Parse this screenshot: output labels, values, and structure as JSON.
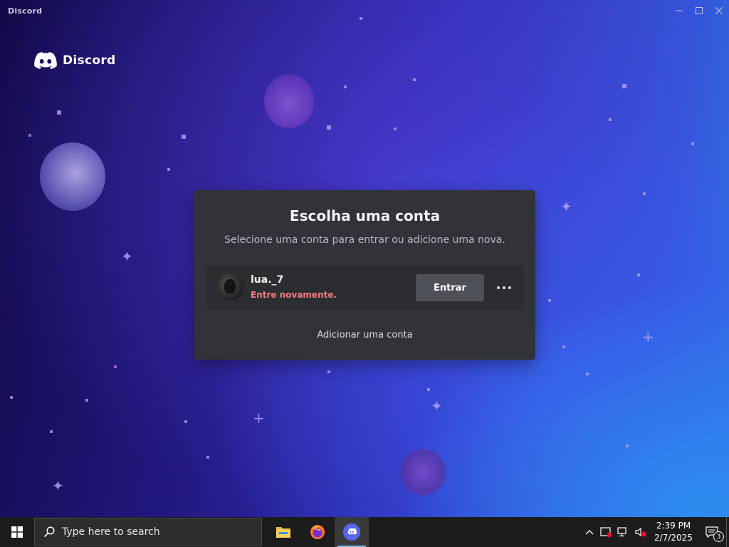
{
  "window": {
    "title": "Discord"
  },
  "brand": {
    "name": "Discord"
  },
  "modal": {
    "title": "Escolha uma conta",
    "subtitle": "Selecione uma conta para entrar ou adicione uma nova.",
    "account": {
      "username": "lua._7",
      "status": "Entre novamente.",
      "login_label": "Entrar"
    },
    "add_account_label": "Adicionar uma conta"
  },
  "taskbar": {
    "search_placeholder": "Type here to search",
    "apps": [
      {
        "name": "file-explorer-icon",
        "active": false
      },
      {
        "name": "firefox-icon",
        "active": false
      },
      {
        "name": "discord-icon",
        "active": true
      }
    ],
    "clock": {
      "time": "2:39 PM",
      "date": "2/7/2025"
    },
    "notification_count": "3"
  },
  "colors": {
    "modal_bg": "#313338",
    "row_bg": "#2b2d31",
    "button_bg": "#4e5058",
    "status_red": "#f57a7f",
    "taskbar_bg": "#1c1c1c",
    "accent_blue": "#5865f2"
  }
}
